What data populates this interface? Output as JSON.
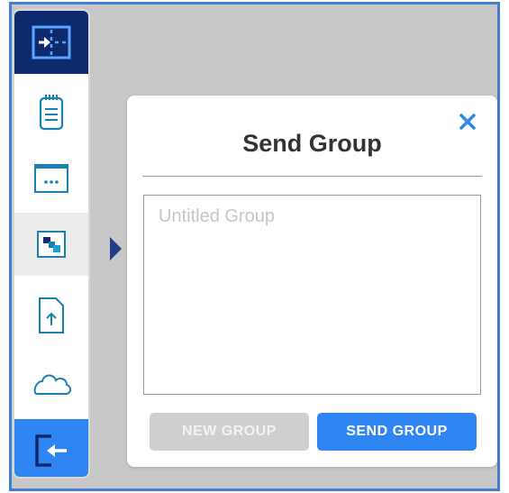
{
  "dialog": {
    "title": "Send Group",
    "input_placeholder": "Untitled Group",
    "input_value": "",
    "new_group_label": "NEW GROUP",
    "send_group_label": "SEND GROUP",
    "close_icon": "close-icon"
  },
  "sidebar": {
    "items": [
      {
        "id": "collapse-panel",
        "icon": "panel-arrow-in-icon",
        "state": "active-header"
      },
      {
        "id": "notes",
        "icon": "notepad-icon",
        "state": "normal"
      },
      {
        "id": "window",
        "icon": "browser-window-icon",
        "state": "normal"
      },
      {
        "id": "groups",
        "icon": "tiles-icon",
        "state": "selected"
      },
      {
        "id": "upload",
        "icon": "file-upload-icon",
        "state": "normal"
      },
      {
        "id": "cloud",
        "icon": "cloud-icon",
        "state": "normal"
      },
      {
        "id": "exit",
        "icon": "exit-arrow-icon",
        "state": "highlight"
      }
    ]
  },
  "colors": {
    "frame_border": "#3f7fd1",
    "backdrop": "#c8c8c8",
    "nav_dark": "#0e2a6e",
    "accent_blue": "#2f86f2",
    "icon_teal": "#1b7fb0",
    "disabled_button": "#cfcfcf",
    "title_text": "#333333"
  }
}
